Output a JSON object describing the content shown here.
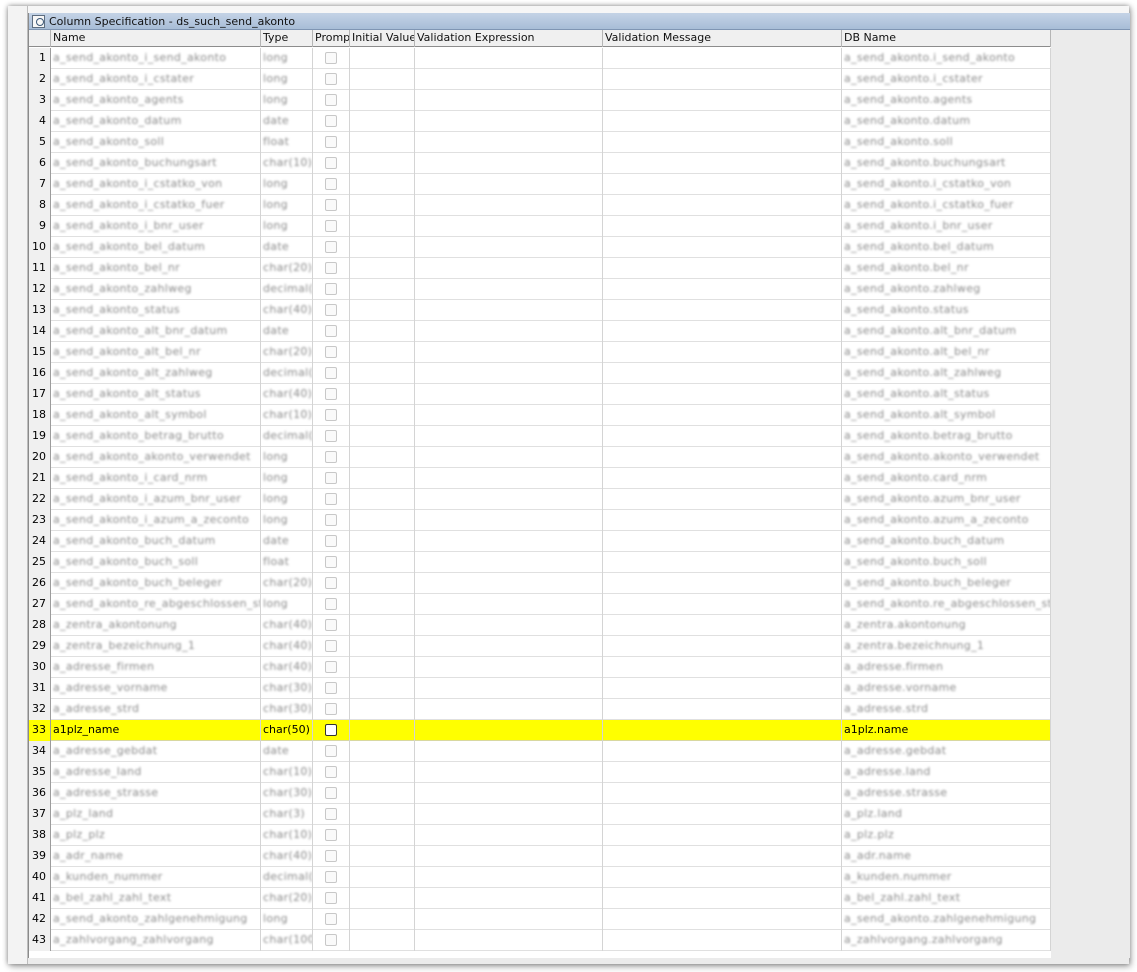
{
  "window": {
    "title": "Column Specification - ds_such_send_akonto"
  },
  "columns": [
    "Name",
    "Type",
    "Prompt",
    "Initial Value",
    "Validation Expression",
    "Validation Message",
    "DB Name"
  ],
  "rows": [
    {
      "num": "1",
      "name": "a_send_akonto_i_send_akonto",
      "type": "long",
      "db": "a_send_akonto.i_send_akonto"
    },
    {
      "num": "2",
      "name": "a_send_akonto_i_cstater",
      "type": "long",
      "db": "a_send_akonto.i_cstater"
    },
    {
      "num": "3",
      "name": "a_send_akonto_agents",
      "type": "long",
      "db": "a_send_akonto.agents"
    },
    {
      "num": "4",
      "name": "a_send_akonto_datum",
      "type": "date",
      "db": "a_send_akonto.datum"
    },
    {
      "num": "5",
      "name": "a_send_akonto_soll",
      "type": "float",
      "db": "a_send_akonto.soll"
    },
    {
      "num": "6",
      "name": "a_send_akonto_buchungsart",
      "type": "char(10)",
      "db": "a_send_akonto.buchungsart"
    },
    {
      "num": "7",
      "name": "a_send_akonto_i_cstatko_von",
      "type": "long",
      "db": "a_send_akonto.i_cstatko_von"
    },
    {
      "num": "8",
      "name": "a_send_akonto_i_cstatko_fuer",
      "type": "long",
      "db": "a_send_akonto.i_cstatko_fuer"
    },
    {
      "num": "9",
      "name": "a_send_akonto_i_bnr_user",
      "type": "long",
      "db": "a_send_akonto.i_bnr_user"
    },
    {
      "num": "10",
      "name": "a_send_akonto_bel_datum",
      "type": "date",
      "db": "a_send_akonto.bel_datum"
    },
    {
      "num": "11",
      "name": "a_send_akonto_bel_nr",
      "type": "char(20)",
      "db": "a_send_akonto.bel_nr"
    },
    {
      "num": "12",
      "name": "a_send_akonto_zahlweg",
      "type": "decimal(2)",
      "db": "a_send_akonto.zahlweg"
    },
    {
      "num": "13",
      "name": "a_send_akonto_status",
      "type": "char(40)",
      "db": "a_send_akonto.status"
    },
    {
      "num": "14",
      "name": "a_send_akonto_alt_bnr_datum",
      "type": "date",
      "db": "a_send_akonto.alt_bnr_datum"
    },
    {
      "num": "15",
      "name": "a_send_akonto_alt_bel_nr",
      "type": "char(20)",
      "db": "a_send_akonto.alt_bel_nr"
    },
    {
      "num": "16",
      "name": "a_send_akonto_alt_zahlweg",
      "type": "decimal(2)",
      "db": "a_send_akonto.alt_zahlweg"
    },
    {
      "num": "17",
      "name": "a_send_akonto_alt_status",
      "type": "char(40)",
      "db": "a_send_akonto.alt_status"
    },
    {
      "num": "18",
      "name": "a_send_akonto_alt_symbol",
      "type": "char(10)",
      "db": "a_send_akonto.alt_symbol"
    },
    {
      "num": "19",
      "name": "a_send_akonto_betrag_brutto",
      "type": "decimal(2)",
      "db": "a_send_akonto.betrag_brutto"
    },
    {
      "num": "20",
      "name": "a_send_akonto_akonto_verwendet",
      "type": "long",
      "db": "a_send_akonto.akonto_verwendet"
    },
    {
      "num": "21",
      "name": "a_send_akonto_i_card_nrm",
      "type": "long",
      "db": "a_send_akonto.card_nrm"
    },
    {
      "num": "22",
      "name": "a_send_akonto_i_azum_bnr_user",
      "type": "long",
      "db": "a_send_akonto.azum_bnr_user"
    },
    {
      "num": "23",
      "name": "a_send_akonto_i_azum_a_zeconto",
      "type": "long",
      "db": "a_send_akonto.azum_a_zeconto"
    },
    {
      "num": "24",
      "name": "a_send_akonto_buch_datum",
      "type": "date",
      "db": "a_send_akonto.buch_datum"
    },
    {
      "num": "25",
      "name": "a_send_akonto_buch_soll",
      "type": "float",
      "db": "a_send_akonto.buch_soll"
    },
    {
      "num": "26",
      "name": "a_send_akonto_buch_beleger",
      "type": "char(20)",
      "db": "a_send_akonto.buch_beleger"
    },
    {
      "num": "27",
      "name": "a_send_akonto_re_abgeschlossen_storno",
      "type": "long",
      "db": "a_send_akonto.re_abgeschlossen_storno"
    },
    {
      "num": "28",
      "name": "a_zentra_akontonung",
      "type": "char(40)",
      "db": "a_zentra.akontonung"
    },
    {
      "num": "29",
      "name": "a_zentra_bezeichnung_1",
      "type": "char(40)",
      "db": "a_zentra.bezeichnung_1"
    },
    {
      "num": "30",
      "name": "a_adresse_firmen",
      "type": "char(40)",
      "db": "a_adresse.firmen"
    },
    {
      "num": "31",
      "name": "a_adresse_vorname",
      "type": "char(30)",
      "db": "a_adresse.vorname"
    },
    {
      "num": "32",
      "name": "a_adresse_strd",
      "type": "char(30)",
      "db": "a_adresse.strd"
    },
    {
      "num": "33",
      "name": "a1plz_name",
      "type": "char(50)",
      "db": "a1plz.name",
      "selected": true
    },
    {
      "num": "34",
      "name": "a_adresse_gebdat",
      "type": "date",
      "db": "a_adresse.gebdat"
    },
    {
      "num": "35",
      "name": "a_adresse_land",
      "type": "char(10)",
      "db": "a_adresse.land"
    },
    {
      "num": "36",
      "name": "a_adresse_strasse",
      "type": "char(30)",
      "db": "a_adresse.strasse"
    },
    {
      "num": "37",
      "name": "a_plz_land",
      "type": "char(3)",
      "db": "a_plz.land"
    },
    {
      "num": "38",
      "name": "a_plz_plz",
      "type": "char(10)",
      "db": "a_plz.plz"
    },
    {
      "num": "39",
      "name": "a_adr_name",
      "type": "char(40)",
      "db": "a_adr.name"
    },
    {
      "num": "40",
      "name": "a_kunden_nummer",
      "type": "decimal(0)",
      "db": "a_kunden.nummer"
    },
    {
      "num": "41",
      "name": "a_bel_zahl_zahl_text",
      "type": "char(20)",
      "db": "a_bel_zahl.zahl_text"
    },
    {
      "num": "42",
      "name": "a_send_akonto_zahlgenehmigung",
      "type": "long",
      "db": "a_send_akonto.zahlgenehmigung"
    },
    {
      "num": "43",
      "name": "a_zahlvorgang_zahlvorgang",
      "type": "char(100)",
      "db": "a_zahlvorgang.zahlvorgang"
    }
  ]
}
